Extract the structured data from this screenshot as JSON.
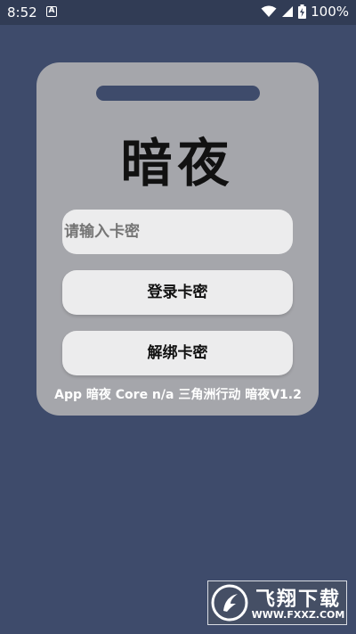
{
  "status_bar": {
    "time": "8:52",
    "notification_icon": "A",
    "battery": "100%"
  },
  "card": {
    "title": "暗夜",
    "input_placeholder": "请输入卡密",
    "login_label": "登录卡密",
    "unbind_label": "解绑卡密"
  },
  "footer": {
    "text": "App 暗夜 Core n/a 三角洲行动 暗夜V1.2"
  },
  "watermark": {
    "name": "飞翔下载",
    "url": "WWW.FXXZ.COM"
  },
  "colors": {
    "background": "#3e4b6b",
    "card": "#a5a6ab",
    "button": "#ececed"
  }
}
